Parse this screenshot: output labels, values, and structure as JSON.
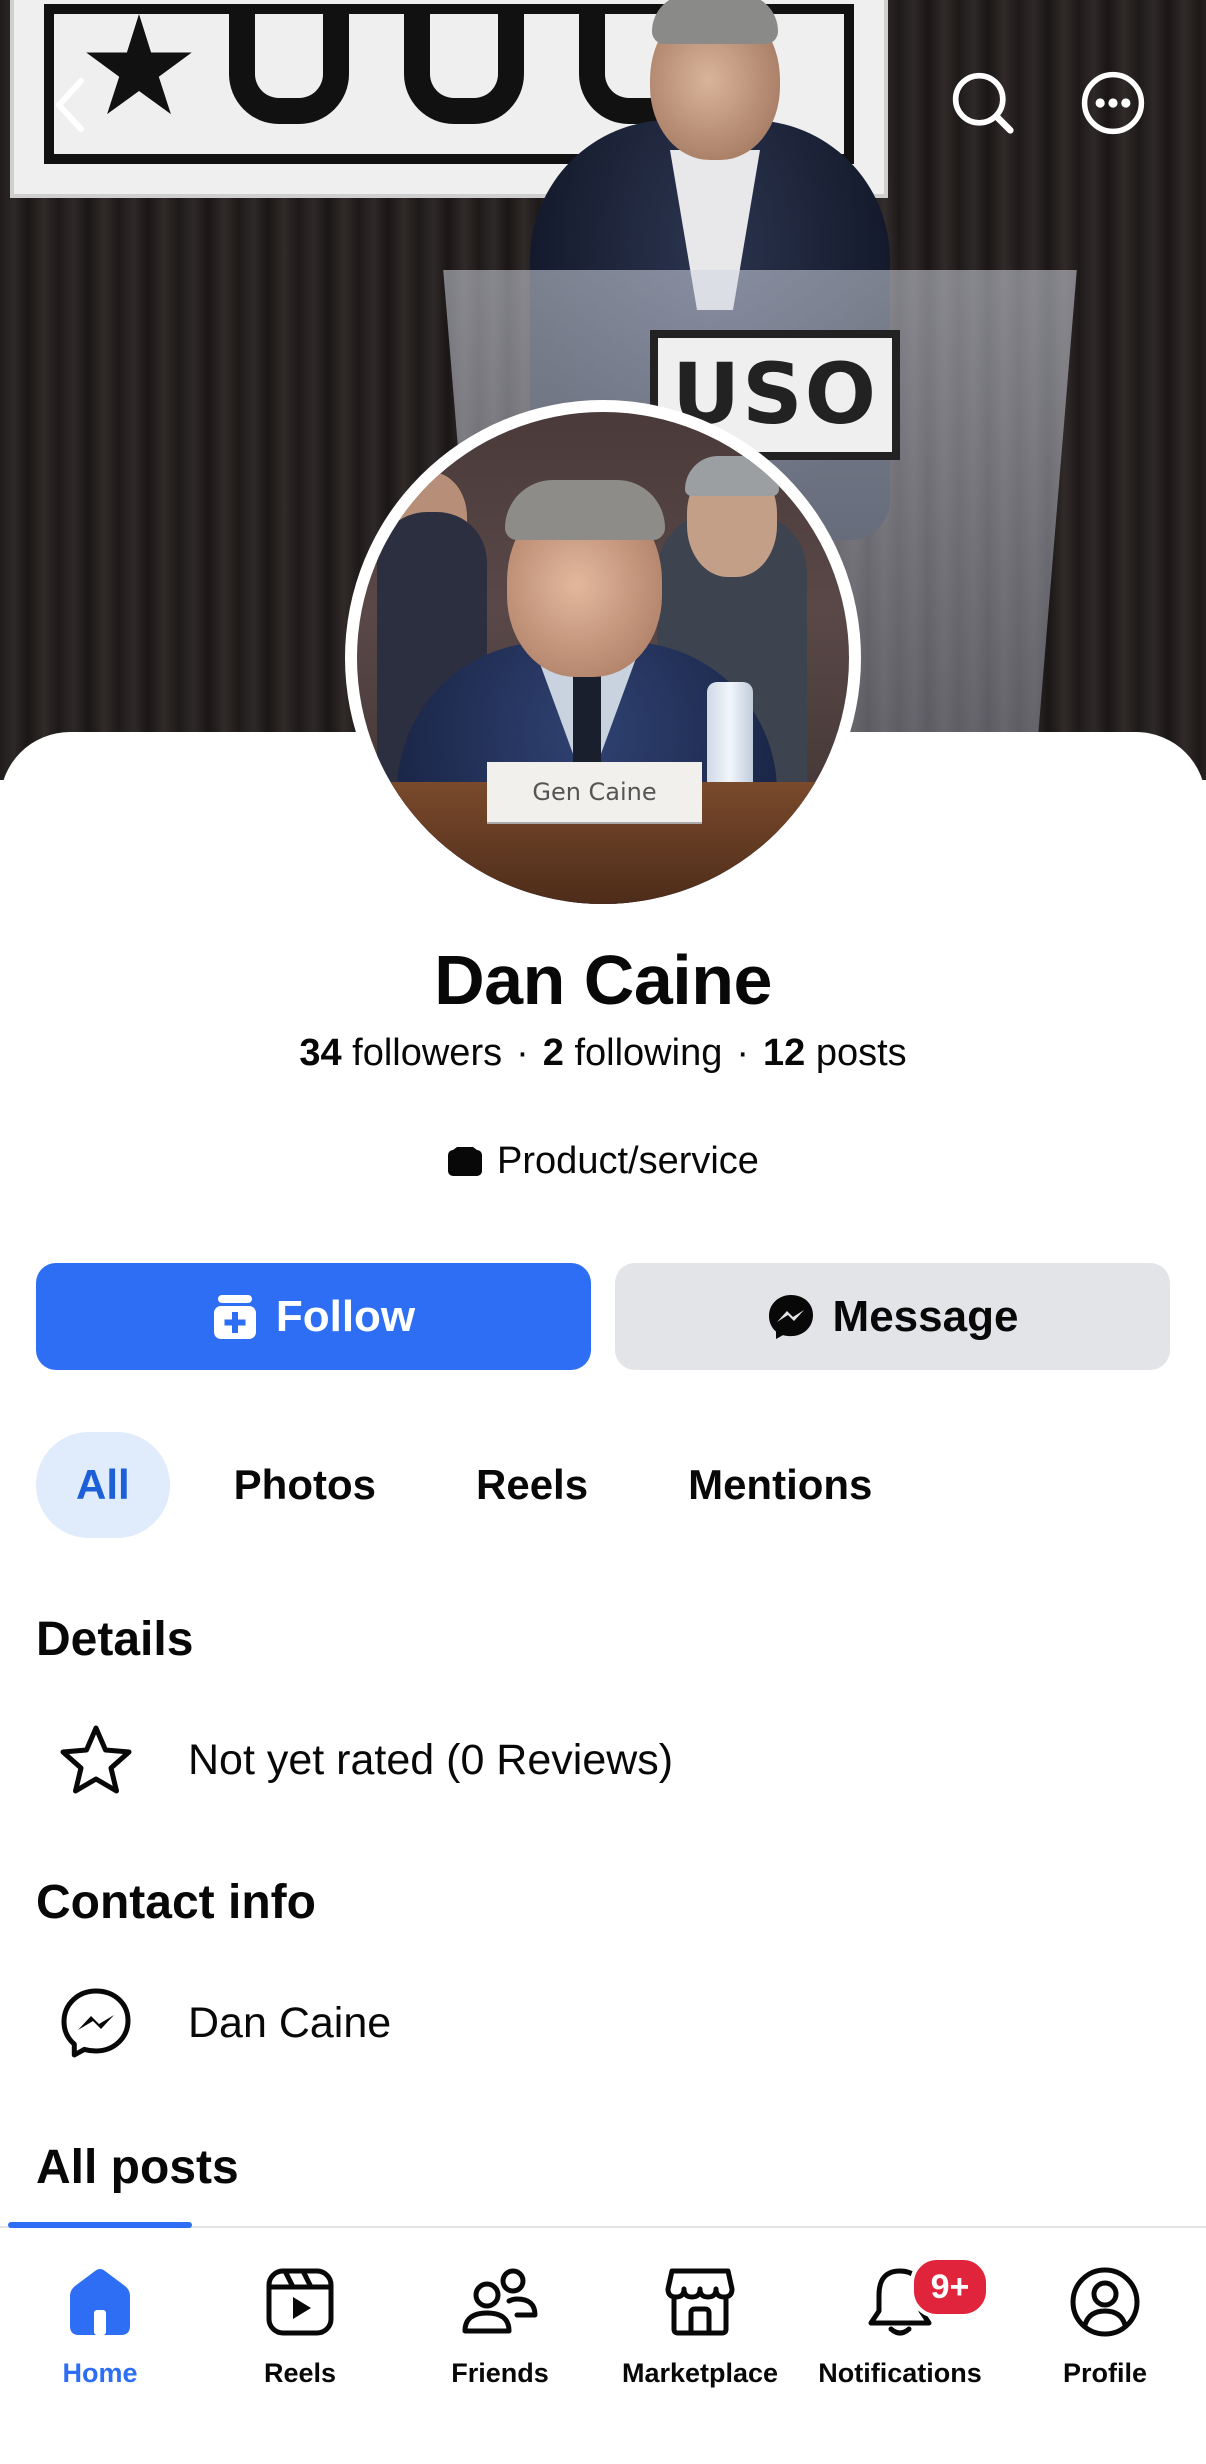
{
  "header": {
    "back_icon": "chevron-left-icon",
    "search_icon": "search-icon",
    "more_icon": "more-dots-icon"
  },
  "cover": {
    "podium_sign": "USO"
  },
  "avatar": {
    "nameplate": "Gen Caine"
  },
  "profile": {
    "name": "Dan Caine",
    "stats": {
      "followers_count": "34",
      "followers_label": "followers",
      "following_count": "2",
      "following_label": "following",
      "posts_count": "12",
      "posts_label": "posts",
      "separator": "·"
    },
    "category": "Product/service",
    "category_icon": "product-icon"
  },
  "actions": {
    "follow_label": "Follow",
    "follow_icon": "follow-icon",
    "message_label": "Message",
    "message_icon": "messenger-icon"
  },
  "filters": [
    "All",
    "Photos",
    "Reels",
    "Mentions"
  ],
  "details": {
    "title": "Details",
    "rating_text": "Not yet rated (0 Reviews)",
    "rating_icon": "star-icon"
  },
  "contact": {
    "title": "Contact info",
    "messenger_name": "Dan Caine",
    "messenger_icon": "messenger-icon"
  },
  "posts": {
    "title": "All posts"
  },
  "tabbar": {
    "items": [
      {
        "label": "Home",
        "icon": "home-icon",
        "active": true
      },
      {
        "label": "Reels",
        "icon": "reels-icon"
      },
      {
        "label": "Friends",
        "icon": "friends-icon"
      },
      {
        "label": "Marketplace",
        "icon": "marketplace-icon"
      },
      {
        "label": "Notifications",
        "icon": "bell-icon",
        "badge": "9+"
      },
      {
        "label": "Profile",
        "icon": "profile-icon"
      }
    ]
  },
  "colors": {
    "accent": "#2d6ef5",
    "chip_active_bg": "#e0ecfc",
    "message_bg": "#e3e4e8",
    "badge": "#e0243c"
  }
}
